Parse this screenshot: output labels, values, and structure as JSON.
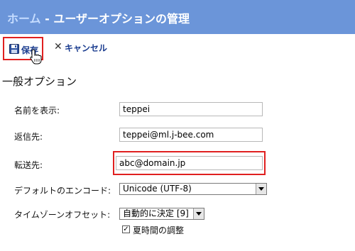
{
  "header": {
    "home_link": "ホーム",
    "separator": " - ",
    "title": "ユーザーオプションの管理"
  },
  "toolbar": {
    "save_label": "保存",
    "cancel_label": "キャンセル"
  },
  "section": {
    "title": "一般オプション"
  },
  "fields": {
    "display_name_label": "名前を表示:",
    "display_name_value": "teppei",
    "reply_to_label": "返信先:",
    "reply_to_value": "teppei@ml.j-bee.com",
    "forward_to_label": "転送先:",
    "forward_to_value": "abc@domain.jp",
    "encoding_label": "デフォルトのエンコード:",
    "encoding_value": "Unicode (UTF-8)",
    "timezone_label": "タイムゾーンオフセット:",
    "timezone_value": "自動的に決定 [9]",
    "dst_label": "夏時間の調整",
    "dst_checked": true
  }
}
